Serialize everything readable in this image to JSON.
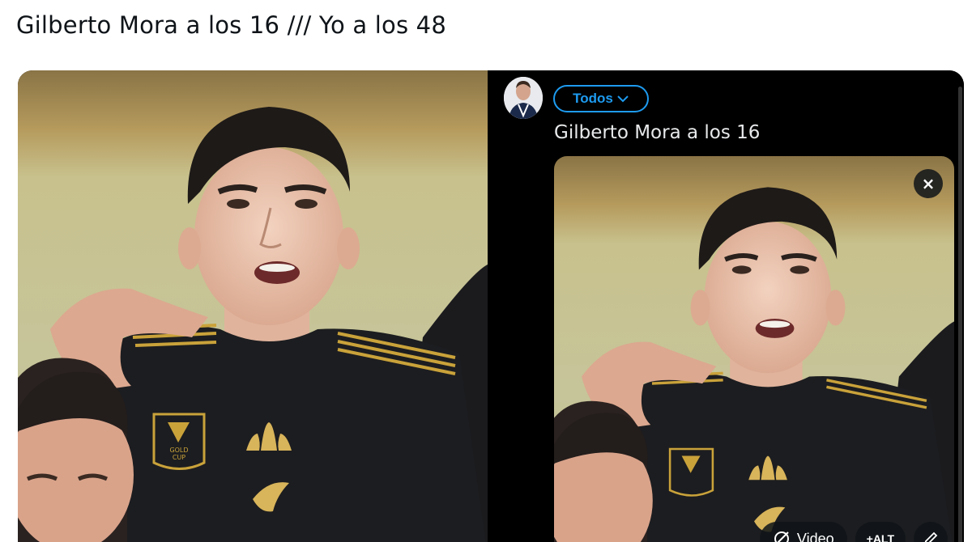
{
  "post": {
    "text": "Gilberto Mora a los 16 /// Yo a los 48"
  },
  "left_photo": {
    "badge_lines": [
      "GOLD",
      "CUP"
    ]
  },
  "composer": {
    "audience_label": "Todos",
    "draft_text": "Gilberto Mora a los 16",
    "media": {
      "remove_symbol": "×",
      "video_label": "Video",
      "alt_label": "+ALT"
    }
  },
  "colors": {
    "accent": "#1d9bf0",
    "text_dark": "#0f1419",
    "composer_bg": "#000000",
    "jersey": "#1c1d20",
    "gold": "#c9a23a"
  },
  "icons": {
    "audience_chevron": "chevron-down-icon",
    "remove": "close-icon",
    "video": "no-video-icon",
    "edit": "pencil-icon"
  }
}
